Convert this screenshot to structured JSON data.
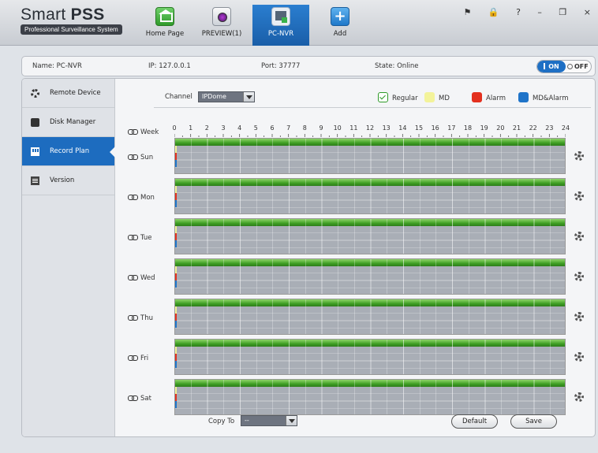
{
  "app": {
    "title_regular": "Smart ",
    "title_bold": "PSS",
    "subtitle": "Professional Surveillance System"
  },
  "nav": [
    {
      "label": "Home Page",
      "icon": "home-icon"
    },
    {
      "label": "PREVIEW(1)",
      "icon": "preview-icon"
    },
    {
      "label": "PC-NVR",
      "icon": "nvr-icon",
      "active": true
    },
    {
      "label": "Add",
      "icon": "plus-icon"
    }
  ],
  "window_controls": "⚑ 🔒 ? – ❐ ×",
  "info": {
    "name": "Name:  PC-NVR",
    "ip": "IP:  127.0.0.1",
    "port": "Port:   37777",
    "state": "State:  Online",
    "on_label": "ON",
    "off_label": "OFF"
  },
  "sidebar": [
    {
      "label": "Remote Device",
      "icon": "settings-icon"
    },
    {
      "label": "Disk Manager",
      "icon": "disk-icon"
    },
    {
      "label": "Record Plan",
      "icon": "record-icon",
      "active": true
    },
    {
      "label": "Version",
      "icon": "version-icon"
    }
  ],
  "record_plan": {
    "channel_label": "Channel",
    "channel_value": "IPDome",
    "legend": [
      {
        "label": "Regular",
        "color": "#2e9a28"
      },
      {
        "label": "MD",
        "color": "#f3f39a"
      },
      {
        "label": "Alarm",
        "color": "#e3301f"
      },
      {
        "label": "MD&Alarm",
        "color": "#1f74c9"
      }
    ],
    "week_label": "Week",
    "hours": [
      "0",
      "1",
      "2",
      "3",
      "4",
      "5",
      "6",
      "7",
      "8",
      "9",
      "10",
      "11",
      "12",
      "13",
      "14",
      "15",
      "16",
      "17",
      "18",
      "19",
      "20",
      "21",
      "22",
      "23",
      "24"
    ],
    "days": [
      "Sun",
      "Mon",
      "Tue",
      "Wed",
      "Thu",
      "Fri",
      "Sat"
    ],
    "copy_to_label": "Copy To",
    "copy_to_value": "--",
    "default_button": "Default",
    "save_button": "Save"
  },
  "colors": {
    "accent": "#1d6cbf",
    "regular": "#3f9f24"
  }
}
